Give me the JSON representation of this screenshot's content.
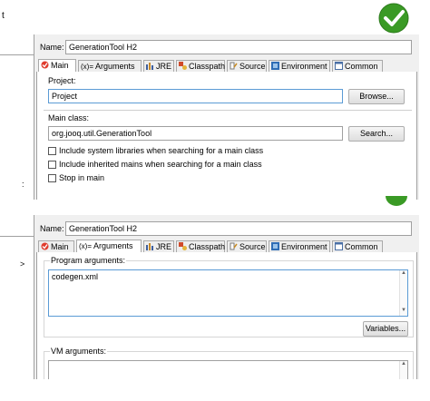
{
  "bg_fragment": {
    "text_top": "t",
    "text_right_mark_1": ":",
    "text_right_mark_2": "ı",
    "text_bottom_mark": "˃"
  },
  "colors": {
    "accent_green": "#3a9a25",
    "focus_border": "#5b9bd5",
    "tab_border": "#a9a9a9"
  },
  "dialog1": {
    "name_label": "Name:",
    "name_value": "GenerationTool H2",
    "tabs": [
      {
        "label": "Main",
        "icon": "main-tab-icon"
      },
      {
        "label": "Arguments",
        "icon": "arguments-tab-icon",
        "prefix": "(x)="
      },
      {
        "label": "JRE",
        "icon": "jre-tab-icon"
      },
      {
        "label": "Classpath",
        "icon": "classpath-tab-icon"
      },
      {
        "label": "Source",
        "icon": "source-tab-icon"
      },
      {
        "label": "Environment",
        "icon": "environment-tab-icon"
      },
      {
        "label": "Common",
        "icon": "common-tab-icon"
      }
    ],
    "project_label": "Project:",
    "project_value": "Project",
    "browse_button": "Browse...",
    "main_class_label": "Main class:",
    "main_class_value": "org.jooq.util.GenerationTool",
    "search_button": "Search...",
    "check_include_system": "Include system libraries when searching for a main class",
    "check_include_inherited": "Include inherited mains when searching for a main class",
    "check_stop_in_main": "Stop in main"
  },
  "dialog2": {
    "name_label": "Name:",
    "name_value": "GenerationTool H2",
    "tabs": [
      {
        "label": "Main",
        "icon": "main-tab-icon"
      },
      {
        "label": "Arguments",
        "icon": "arguments-tab-icon",
        "prefix": "(x)="
      },
      {
        "label": "JRE",
        "icon": "jre-tab-icon"
      },
      {
        "label": "Classpath",
        "icon": "classpath-tab-icon"
      },
      {
        "label": "Source",
        "icon": "source-tab-icon"
      },
      {
        "label": "Environment",
        "icon": "environment-tab-icon"
      },
      {
        "label": "Common",
        "icon": "common-tab-icon"
      }
    ],
    "program_args_label": "Program arguments:",
    "program_args_value": "codegen.xml",
    "variables_button": "Variables...",
    "vm_args_label": "VM arguments:"
  }
}
